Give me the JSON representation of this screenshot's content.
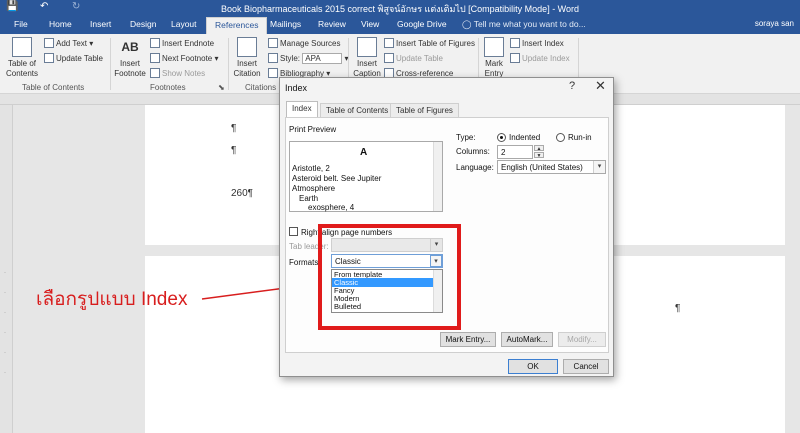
{
  "titlebar": {
    "document_title": "Book Biopharmaceuticals 2015 correct พิสูจน์อักษร แต่งเติมไป [Compatibility Mode] - Word",
    "save_icon": "save-icon",
    "undo_icon": "undo-icon",
    "redo_icon": "redo-icon"
  },
  "tabs": {
    "file": "File",
    "home": "Home",
    "insert": "Insert",
    "design": "Design",
    "layout": "Layout",
    "references": "References",
    "mailings": "Mailings",
    "review": "Review",
    "view": "View",
    "google_drive": "Google Drive",
    "tell_me": "Tell me what you want to do...",
    "user": "soraya san"
  },
  "ribbon": {
    "toc": {
      "button": "Table of Contents",
      "add_text": "Add Text",
      "update_table": "Update Table",
      "group": "Table of Contents"
    },
    "footnotes": {
      "insert_footnote": "Insert Footnote",
      "insert_endnote": "Insert Endnote",
      "next_footnote": "Next Footnote",
      "show_notes": "Show Notes",
      "group": "Footnotes",
      "ab_badge": "AB"
    },
    "citations": {
      "insert_citation": "Insert Citation",
      "manage_sources": "Manage Sources",
      "style_label": "Style:",
      "style_value": "APA",
      "bibliography": "Bibliography",
      "group": "Citations"
    },
    "captions": {
      "insert_caption": "Insert Caption",
      "insert_table_of_figures": "Insert Table of Figures",
      "update_table": "Update Table",
      "cross_reference": "Cross-reference"
    },
    "index": {
      "mark_entry": "Mark Entry",
      "insert_index": "Insert Index",
      "update_index": "Update Index"
    }
  },
  "document": {
    "page_number": "260¶",
    "pilcrow": "¶"
  },
  "annotation": {
    "text": "เลือกรูปแบบ Index",
    "color": "#d81e1e"
  },
  "dialog": {
    "title": "Index",
    "help": "?",
    "close": "✕",
    "tabs": [
      "Index",
      "Table of Contents",
      "Table of Figures"
    ],
    "print_preview_label": "Print Preview",
    "preview_lines": [
      "A",
      "Aristotle, 2",
      "Asteroid belt. See Jupiter",
      "Atmosphere",
      "Earth",
      "exosphere, 4"
    ],
    "type_label": "Type:",
    "type_indented": "Indented",
    "type_runin": "Run-in",
    "columns_label": "Columns:",
    "columns_value": "2",
    "language_label": "Language:",
    "language_value": "English (United States)",
    "right_align_label": "Right align page numbers",
    "tab_leader_label": "Tab leader:",
    "formats_label": "Formats:",
    "formats_value": "Classic",
    "formats_options": [
      "From template",
      "Classic",
      "Fancy",
      "Modern",
      "Bulleted"
    ],
    "mark_entry_button": "Mark Entry...",
    "automark_button": "AutoMark...",
    "modify_button": "Modify...",
    "ok_button": "OK",
    "cancel_button": "Cancel"
  },
  "colors": {
    "word_blue": "#2b579a",
    "highlight_red": "#e01b1b",
    "selection_blue": "#3399ff"
  }
}
